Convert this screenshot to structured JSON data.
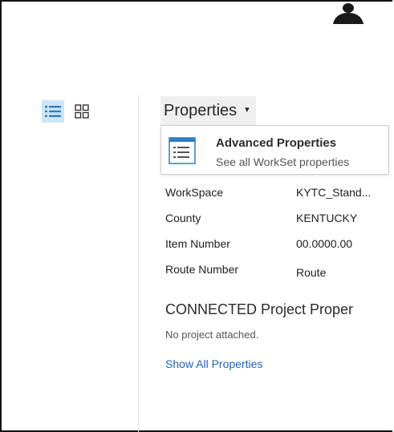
{
  "view_toggle": {
    "list_icon": "list-view-icon",
    "grid_icon": "grid-view-icon",
    "active": "list"
  },
  "properties_menu": {
    "label": "Properties",
    "caret": "▾"
  },
  "advanced": {
    "icon": "document-list-icon",
    "title": "Advanced Properties",
    "subtitle": "See all WorkSet properties"
  },
  "properties": [
    {
      "key": "WorkSpace",
      "value": "KYTC_Stand..."
    },
    {
      "key": "County",
      "value": "KENTUCKY"
    },
    {
      "key": "Item Number",
      "value": "00.0000.00"
    },
    {
      "key": "Route Number",
      "value": "Route"
    }
  ],
  "connected": {
    "title": "CONNECTED Project Proper",
    "empty_text": "No project attached."
  },
  "show_all_link": "Show All Properties",
  "colors": {
    "accent_link": "#1d63b8",
    "active_toggle_bg": "#cde6f7",
    "icon_blue": "#2f7fc4"
  }
}
